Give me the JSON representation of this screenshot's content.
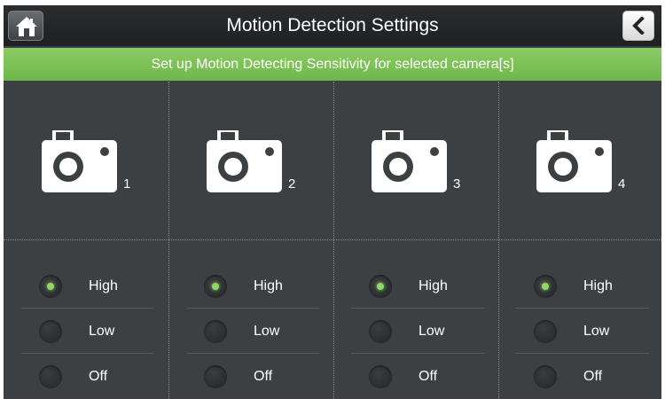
{
  "header": {
    "title": "Motion Detection Settings",
    "home_icon": "home-icon",
    "back_icon": "chevron-left-icon"
  },
  "subtitle": "Set up Motion Detecting Sensitivity for selected camera[s]",
  "colors": {
    "accent": "#7fc257",
    "background": "#3d4043",
    "selected_dot": "#8fd866"
  },
  "cameras": [
    {
      "number": "1",
      "icon": "camera-icon",
      "options": [
        "High",
        "Low",
        "Off"
      ],
      "selected": "High"
    },
    {
      "number": "2",
      "icon": "camera-icon",
      "options": [
        "High",
        "Low",
        "Off"
      ],
      "selected": "High"
    },
    {
      "number": "3",
      "icon": "camera-icon",
      "options": [
        "High",
        "Low",
        "Off"
      ],
      "selected": "High"
    },
    {
      "number": "4",
      "icon": "camera-icon",
      "options": [
        "High",
        "Low",
        "Off"
      ],
      "selected": "High"
    }
  ]
}
